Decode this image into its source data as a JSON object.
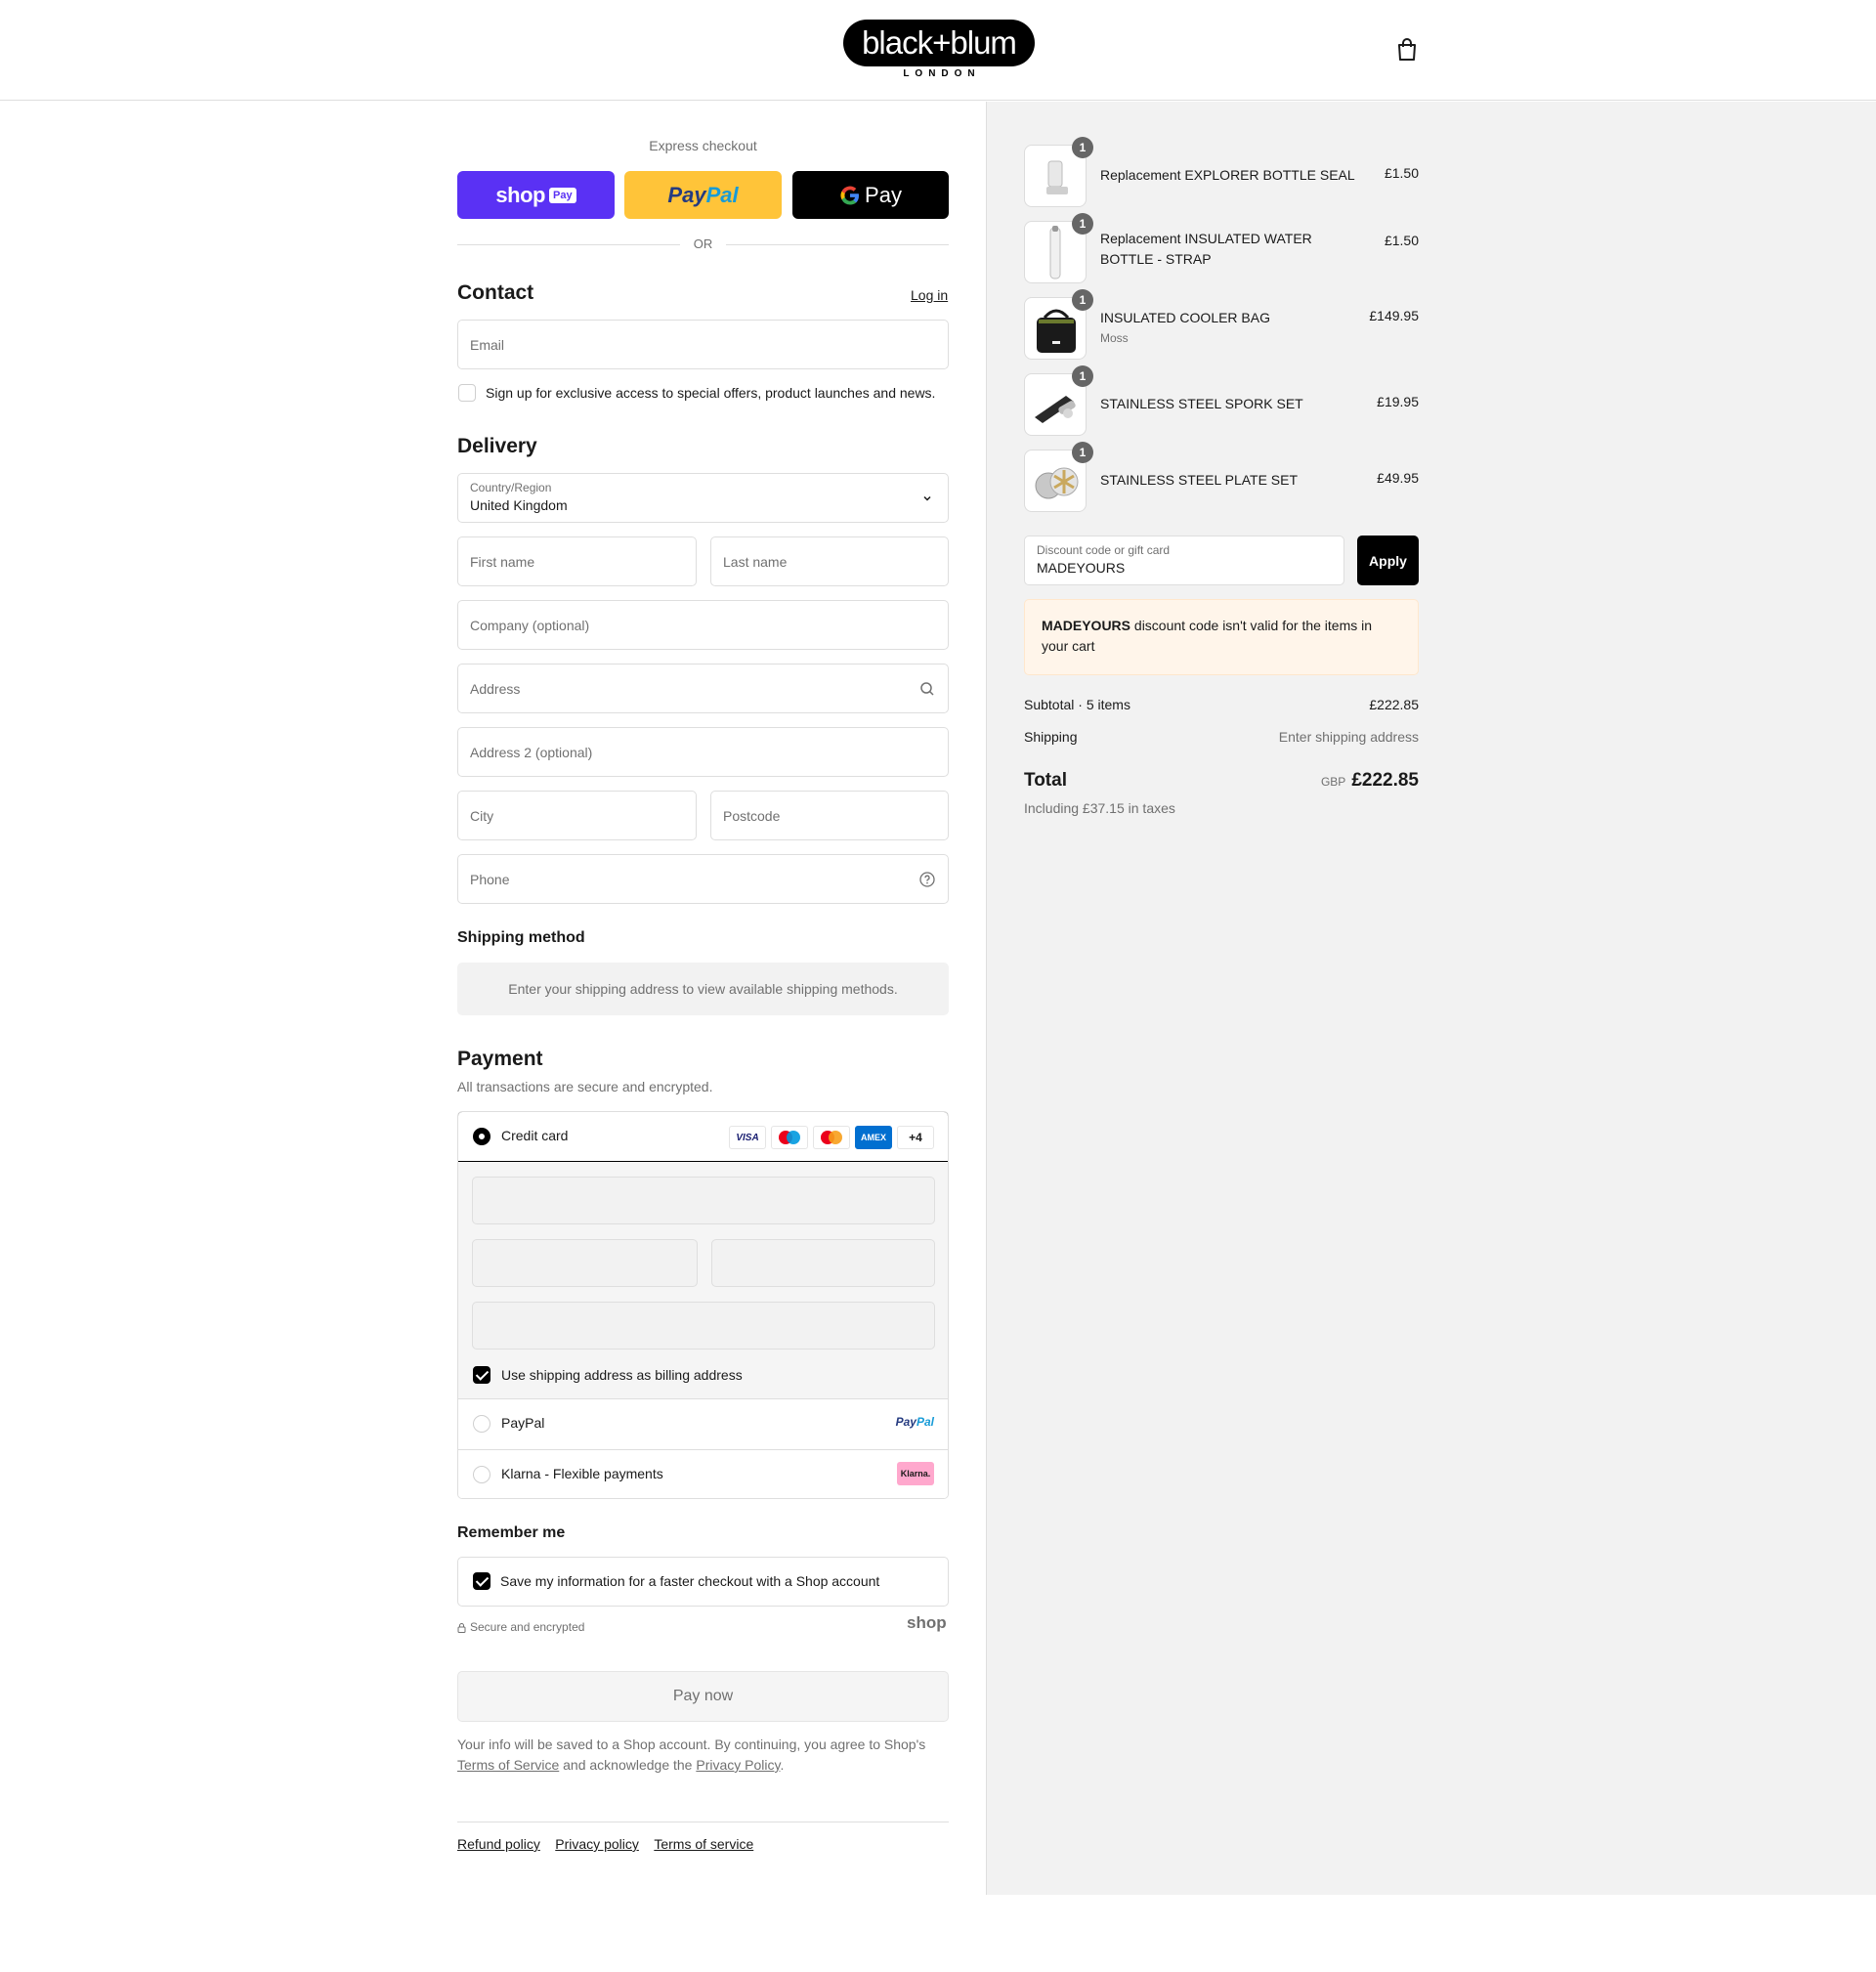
{
  "header": {
    "logo_text": "black+blum",
    "logo_sub": "LONDON",
    "cart_icon": "shopping-bag-icon"
  },
  "express": {
    "title": "Express checkout",
    "shop_label": "shop",
    "shop_tag": "Pay",
    "paypal_a": "Pay",
    "paypal_b": "Pal",
    "gpay_label": "Pay",
    "or": "OR"
  },
  "contact": {
    "title": "Contact",
    "login": "Log in",
    "email_placeholder": "Email",
    "newsletter": "Sign up for exclusive access to special offers, product launches and news."
  },
  "delivery": {
    "title": "Delivery",
    "country_label": "Country/Region",
    "country_value": "United Kingdom",
    "first_name": "First name",
    "last_name": "Last name",
    "company": "Company (optional)",
    "address": "Address",
    "address2": "Address 2 (optional)",
    "city": "City",
    "postcode": "Postcode",
    "phone": "Phone"
  },
  "shipping_method": {
    "title": "Shipping method",
    "message": "Enter your shipping address to view available shipping methods."
  },
  "payment": {
    "title": "Payment",
    "subtitle": "All transactions are secure and encrypted.",
    "credit_card": "Credit card",
    "card_more": "+4",
    "card_brands": [
      "VISA",
      "Maestro",
      "Mastercard",
      "AMEX"
    ],
    "billing_same": "Use shipping address as billing address",
    "paypal": "PayPal",
    "paypal_logo_a": "Pay",
    "paypal_logo_b": "Pal",
    "klarna": "Klarna - Flexible payments",
    "klarna_logo": "Klarna."
  },
  "remember": {
    "title": "Remember me",
    "save": "Save my information for a faster checkout with a Shop account",
    "secure": "Secure and encrypted",
    "shop_logo": "shop"
  },
  "pay_now": "Pay now",
  "legal": {
    "pre": "Your info will be saved to a Shop account. By continuing, you agree to Shop's",
    "terms": "Terms of Service",
    "mid": "and acknowledge the",
    "privacy": "Privacy Policy",
    "end": "."
  },
  "footer": {
    "refund": "Refund policy",
    "privacy": "Privacy policy",
    "terms": "Terms of service"
  },
  "cart": {
    "items": [
      {
        "qty": "1",
        "name": "Replacement EXPLORER BOTTLE SEAL",
        "variant": "",
        "price": "£1.50"
      },
      {
        "qty": "1",
        "name": "Replacement INSULATED WATER BOTTLE - STRAP",
        "variant": "",
        "price": "£1.50"
      },
      {
        "qty": "1",
        "name": "INSULATED COOLER BAG",
        "variant": "Moss",
        "price": "£149.95"
      },
      {
        "qty": "1",
        "name": "STAINLESS STEEL SPORK SET",
        "variant": "",
        "price": "£19.95"
      },
      {
        "qty": "1",
        "name": "STAINLESS STEEL PLATE SET",
        "variant": "",
        "price": "£49.95"
      }
    ],
    "discount_label": "Discount code or gift card",
    "discount_value": "MADEYOURS",
    "apply": "Apply",
    "warning_code": "MADEYOURS",
    "warning_text": " discount code isn't valid for the items in your cart",
    "subtotal_label": "Subtotal · 5 items",
    "subtotal_value": "£222.85",
    "shipping_label": "Shipping",
    "shipping_value": "Enter shipping address",
    "total_label": "Total",
    "currency": "GBP",
    "total_value": "£222.85",
    "taxes": "Including £37.15 in taxes"
  },
  "colors": {
    "shop_purple": "#5a31f4",
    "paypal_yellow": "#ffc439",
    "summary_bg": "#f2f2f2",
    "warning_bg": "#fff5ea"
  }
}
